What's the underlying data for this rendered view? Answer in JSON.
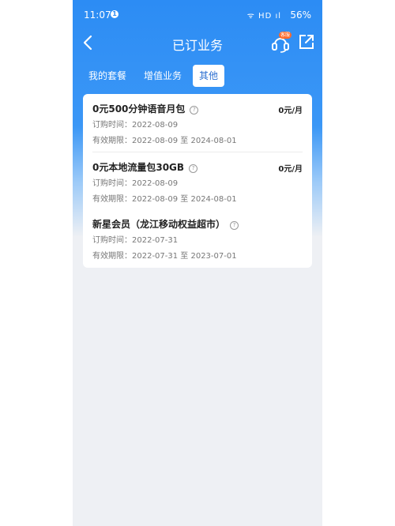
{
  "status": {
    "time": "11:07",
    "notif_count": "1",
    "signal": "ᯤ HD ıl",
    "battery": "56%"
  },
  "header": {
    "title": "已订业务",
    "badge": "客服"
  },
  "tabs": [
    {
      "label": "我的套餐"
    },
    {
      "label": "增值业务"
    },
    {
      "label": "其他"
    }
  ],
  "items": [
    {
      "name": "0元500分钟语音月包",
      "price": "0元/月",
      "order_label": "订购时间：",
      "order_date": "2022-08-09",
      "valid_label": "有效期限：",
      "valid_range": "2022-08-09 至 2024-08-01"
    },
    {
      "name": "0元本地流量包30GB",
      "price": "0元/月",
      "order_label": "订购时间：",
      "order_date": "2022-08-09",
      "valid_label": "有效期限：",
      "valid_range": "2022-08-09 至 2024-08-01"
    },
    {
      "name": "新星会员（龙江移动权益超市）",
      "price": "",
      "order_label": "订购时间：",
      "order_date": "2022-07-31",
      "valid_label": "有效期限：",
      "valid_range": "2022-07-31 至 2023-07-01"
    }
  ],
  "help_glyph": "?",
  "colors": {
    "primary": "#2c8cf4",
    "tab_active_text": "#2c6fd1",
    "badge": "#ff6a2a",
    "background": "#eef0f4"
  }
}
